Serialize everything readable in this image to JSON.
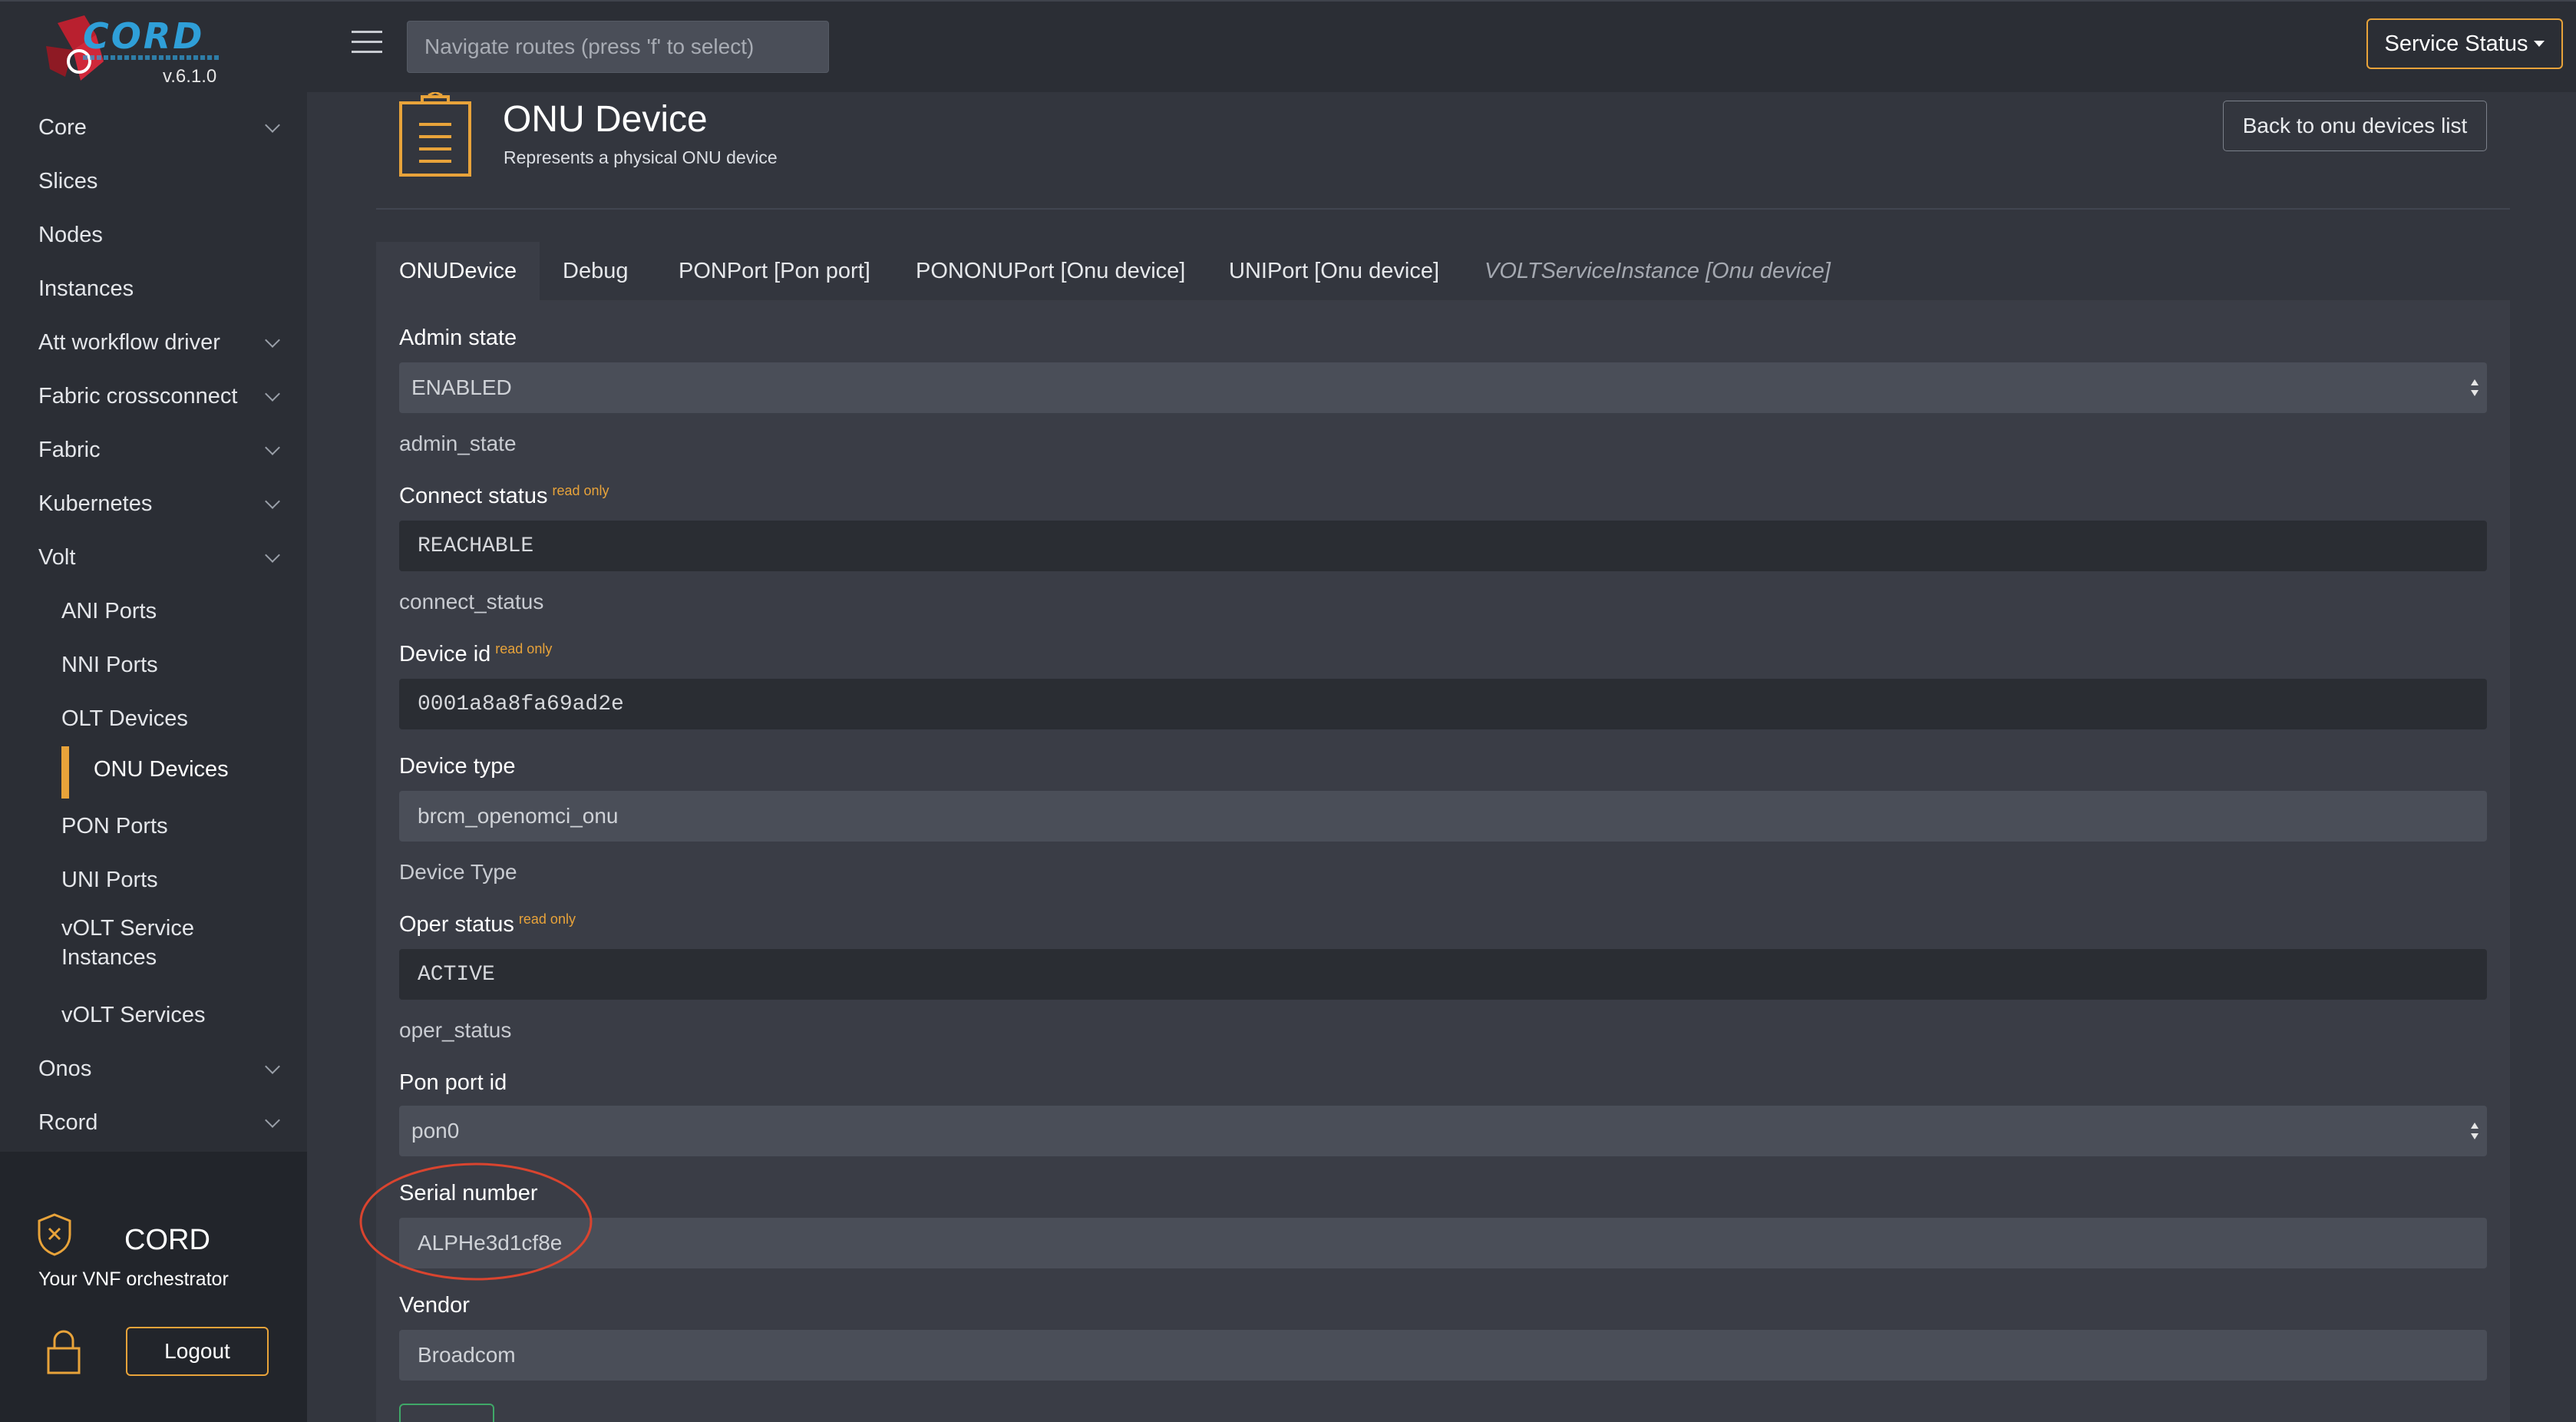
{
  "app": {
    "version": "v.6.1.0",
    "logo_text": "CORD"
  },
  "topbar": {
    "route_placeholder": "Navigate routes (press 'f' to select)",
    "service_status_label": "Service Status"
  },
  "sidebar": {
    "items": [
      {
        "label": "Core",
        "expandable": true
      },
      {
        "label": "Slices",
        "expandable": false
      },
      {
        "label": "Nodes",
        "expandable": false
      },
      {
        "label": "Instances",
        "expandable": false
      },
      {
        "label": "Att workflow driver",
        "expandable": true
      },
      {
        "label": "Fabric crossconnect",
        "expandable": true
      },
      {
        "label": "Fabric",
        "expandable": true
      },
      {
        "label": "Kubernetes",
        "expandable": true
      },
      {
        "label": "Volt",
        "expandable": true
      },
      {
        "label": "ANI Ports",
        "sub": true
      },
      {
        "label": "NNI Ports",
        "sub": true
      },
      {
        "label": "OLT Devices",
        "sub": true
      },
      {
        "label": "ONU Devices",
        "sub": true,
        "active": true
      },
      {
        "label": "PON Ports",
        "sub": true
      },
      {
        "label": "UNI Ports",
        "sub": true
      },
      {
        "label": "vOLT Service Instances",
        "sub": true
      },
      {
        "label": "vOLT Services",
        "sub": true
      },
      {
        "label": "Onos",
        "expandable": true
      },
      {
        "label": "Rcord",
        "expandable": true
      }
    ],
    "footer": {
      "title": "CORD",
      "subtitle": "Your VNF orchestrator",
      "logout_label": "Logout"
    }
  },
  "header": {
    "title": "ONU Device",
    "subtitle": "Represents a physical ONU device",
    "back_label": "Back to onu devices list"
  },
  "tabs": [
    {
      "label": "ONUDevice",
      "active": true
    },
    {
      "label": "Debug"
    },
    {
      "label": "PONPort [Pon port]"
    },
    {
      "label": "PONONUPort [Onu device]"
    },
    {
      "label": "UNIPort [Onu device]"
    },
    {
      "label": "VOLTServiceInstance [Onu device]",
      "disabled": true
    }
  ],
  "form": {
    "read_only_badge": "read only",
    "admin_state": {
      "label": "Admin state",
      "value": "ENABLED",
      "help": "admin_state"
    },
    "connect_status": {
      "label": "Connect status",
      "value": "REACHABLE",
      "help": "connect_status"
    },
    "device_id": {
      "label": "Device id",
      "value": "0001a8a8fa69ad2e"
    },
    "device_type": {
      "label": "Device type",
      "value": "brcm_openomci_onu",
      "help": "Device Type"
    },
    "oper_status": {
      "label": "Oper status",
      "value": "ACTIVE",
      "help": "oper_status"
    },
    "pon_port_id": {
      "label": "Pon port id",
      "value": "pon0"
    },
    "serial_number": {
      "label": "Serial number",
      "value": "ALPHe3d1cf8e"
    },
    "vendor": {
      "label": "Vendor",
      "value": "Broadcom"
    }
  },
  "colors": {
    "accent": "#e8a33a",
    "annotation": "#d9442f",
    "save": "#3fa868"
  }
}
